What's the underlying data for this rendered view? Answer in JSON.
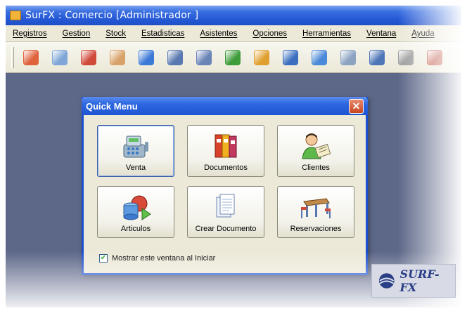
{
  "window": {
    "title": "SurFX :  Comercio [Administrador ]"
  },
  "menu": {
    "items": [
      {
        "label": "Registros"
      },
      {
        "label": "Gestion"
      },
      {
        "label": "Stock"
      },
      {
        "label": "Estadisticas"
      },
      {
        "label": "Asistentes"
      },
      {
        "label": "Opciones"
      },
      {
        "label": "Herramientas"
      },
      {
        "label": "Ventana"
      },
      {
        "label": "Ayuda"
      }
    ]
  },
  "toolbar": {
    "icons": [
      {
        "name": "power-icon",
        "color": "#e0623c"
      },
      {
        "name": "star-document-icon",
        "color": "#7fa6d6"
      },
      {
        "name": "binders-icon",
        "color": "#d04a3a"
      },
      {
        "name": "user-icon",
        "color": "#d8a36a"
      },
      {
        "name": "shapes-icon",
        "color": "#3d7ad6"
      },
      {
        "name": "report-icon",
        "color": "#5a78b0"
      },
      {
        "name": "form-edit-icon",
        "color": "#6a84b8"
      },
      {
        "name": "arrows-exchange-icon",
        "color": "#3f9c3a"
      },
      {
        "name": "clock-icon",
        "color": "#e0a030"
      },
      {
        "name": "bag-icon",
        "color": "#3c6fc0"
      },
      {
        "name": "tag-icon",
        "color": "#4b8ad8"
      },
      {
        "name": "calendar-icon",
        "color": "#8ca3c2"
      },
      {
        "name": "calculator-icon",
        "color": "#4f77b8"
      },
      {
        "name": "printer-icon",
        "color": "#9c9c9c"
      },
      {
        "name": "truck-icon",
        "color": "#c05a4a"
      }
    ]
  },
  "dialog": {
    "title": "Quick Menu",
    "buttons": [
      {
        "label": "Venta",
        "icon": "cash-register-icon"
      },
      {
        "label": "Documentos",
        "icon": "binders-icon"
      },
      {
        "label": "Clientes",
        "icon": "client-icon"
      },
      {
        "label": "Articulos",
        "icon": "shapes-icon"
      },
      {
        "label": "Crear Documento",
        "icon": "new-document-icon"
      },
      {
        "label": "Reservaciones",
        "icon": "table-chairs-icon"
      }
    ],
    "show_on_start": {
      "label": "Mostrar este ventana al Iniciar",
      "checked": true
    }
  },
  "watermark": {
    "text": "SURF-FX"
  }
}
